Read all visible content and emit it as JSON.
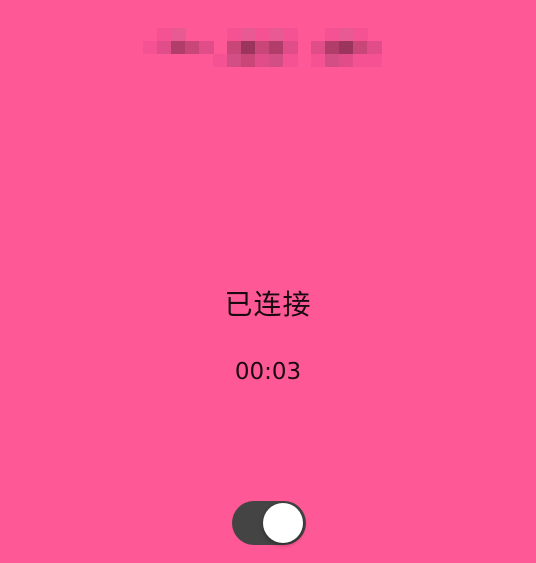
{
  "call": {
    "status": "已连接",
    "duration": "00:03",
    "caller_name_obscured": true
  },
  "toggle": {
    "state": "on"
  },
  "colors": {
    "background": "#FF5896",
    "text": "#1a0a10",
    "toggle_track": "#444444",
    "toggle_knob": "#ffffff"
  },
  "icons": {
    "toggle": "toggle-switch-icon"
  }
}
